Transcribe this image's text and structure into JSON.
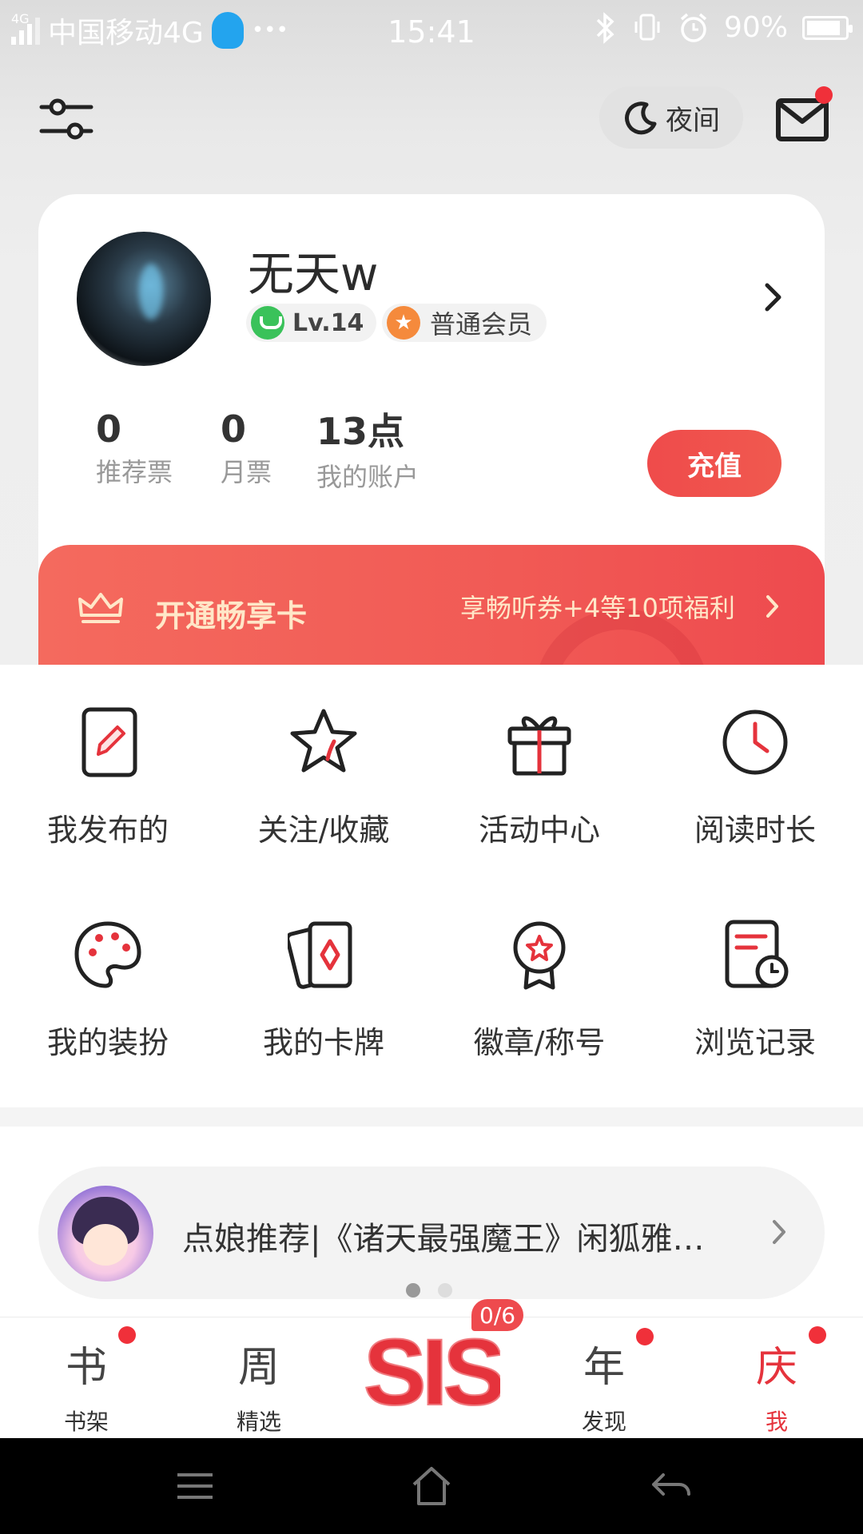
{
  "status_bar": {
    "network_small": "4G",
    "carrier": "中国移动4G",
    "more": "•••",
    "time": "15:41",
    "battery": "90%",
    "battery_level": 0.9
  },
  "top": {
    "night_label": "夜间",
    "mail_has_badge": true
  },
  "profile": {
    "username": "无天w",
    "level": "Lv.14",
    "member_type": "普通会员",
    "stats": [
      {
        "value": "0",
        "label": "推荐票"
      },
      {
        "value": "0",
        "label": "月票"
      },
      {
        "value": "13点",
        "label": "我的账户"
      }
    ],
    "recharge_label": "充值"
  },
  "vip_banner": {
    "title": "开通畅享卡",
    "description": "享畅听券+4等10项福利"
  },
  "grid": [
    {
      "label": "我发布的",
      "icon": "edit-icon"
    },
    {
      "label": "关注/收藏",
      "icon": "star-icon"
    },
    {
      "label": "活动中心",
      "icon": "gift-icon"
    },
    {
      "label": "阅读时长",
      "icon": "clock-icon"
    },
    {
      "label": "我的装扮",
      "icon": "palette-icon"
    },
    {
      "label": "我的卡牌",
      "icon": "cards-icon"
    },
    {
      "label": "徽章/称号",
      "icon": "badge-icon"
    },
    {
      "label": "浏览记录",
      "icon": "history-icon"
    }
  ],
  "recommend": {
    "text": "点娘推荐|《诸天最强魔王》闲狐雅…",
    "page_index": 1,
    "page_count": 2
  },
  "bottom_nav": {
    "items": [
      {
        "glyph": "书",
        "label": "书架",
        "badge": true
      },
      {
        "glyph": "周",
        "label": "精选",
        "badge": false
      },
      {
        "glyph": "年",
        "label": "发现",
        "badge": true
      },
      {
        "glyph": "庆",
        "label": "我",
        "badge": true,
        "active": true
      }
    ],
    "center_logo_text": "SIS",
    "center_badge": "0/6"
  },
  "colors": {
    "accent": "#ee4a4e",
    "vip_text": "#ffe7c8",
    "level_green": "#3ac25a",
    "member_orange": "#f58a3c"
  }
}
